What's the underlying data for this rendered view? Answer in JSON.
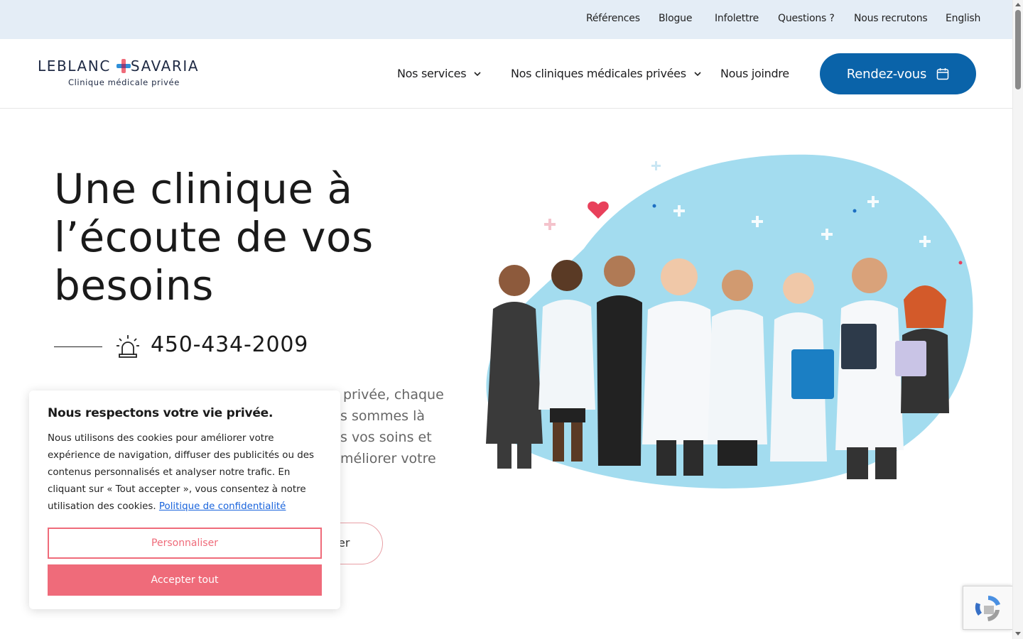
{
  "topbar": {
    "links": [
      "Références",
      "Blogue",
      "Infolettre",
      "Questions ?",
      "Nous recrutons",
      "English"
    ]
  },
  "logo": {
    "main_left": "LEBLANC",
    "main_right": "SAVARIA",
    "subtitle": "Clinique médicale privée"
  },
  "nav": {
    "services": "Nos services",
    "clinics": "Nos cliniques médicales privées",
    "contact": "Nous joindre",
    "cta": "Rendez-vous"
  },
  "hero": {
    "title": "Une clinique à l’écoute de vos besoins",
    "phone": "450-434-2009",
    "text_lines": [
      "",
      "s sommes là",
      "s vos soins et",
      "méliorer votre"
    ],
    "text_line1_visible": "privée, chaque",
    "button_label": "er"
  },
  "cookie": {
    "title": "Nous respectons votre vie privée.",
    "body": "Nous utilisons des cookies pour améliorer votre expérience de navigation, diffuser des publicités ou des contenus personnalisés et analyser notre trafic. En cliquant sur « Tout accepter », vous consentez à notre utilisation des cookies.",
    "policy_link": "Politique de confidentialité",
    "customize": "Personnaliser",
    "accept": "Accepter tout"
  },
  "colors": {
    "brand_blue": "#0a63a9",
    "accent_pink": "#ef6b7a",
    "topbar_bg": "#e4edf6",
    "blob": "#a3dcef"
  },
  "icons": [
    "chevron-down-icon",
    "calendar-icon",
    "siren-icon",
    "logo-cross-icon",
    "recaptcha-icon"
  ]
}
